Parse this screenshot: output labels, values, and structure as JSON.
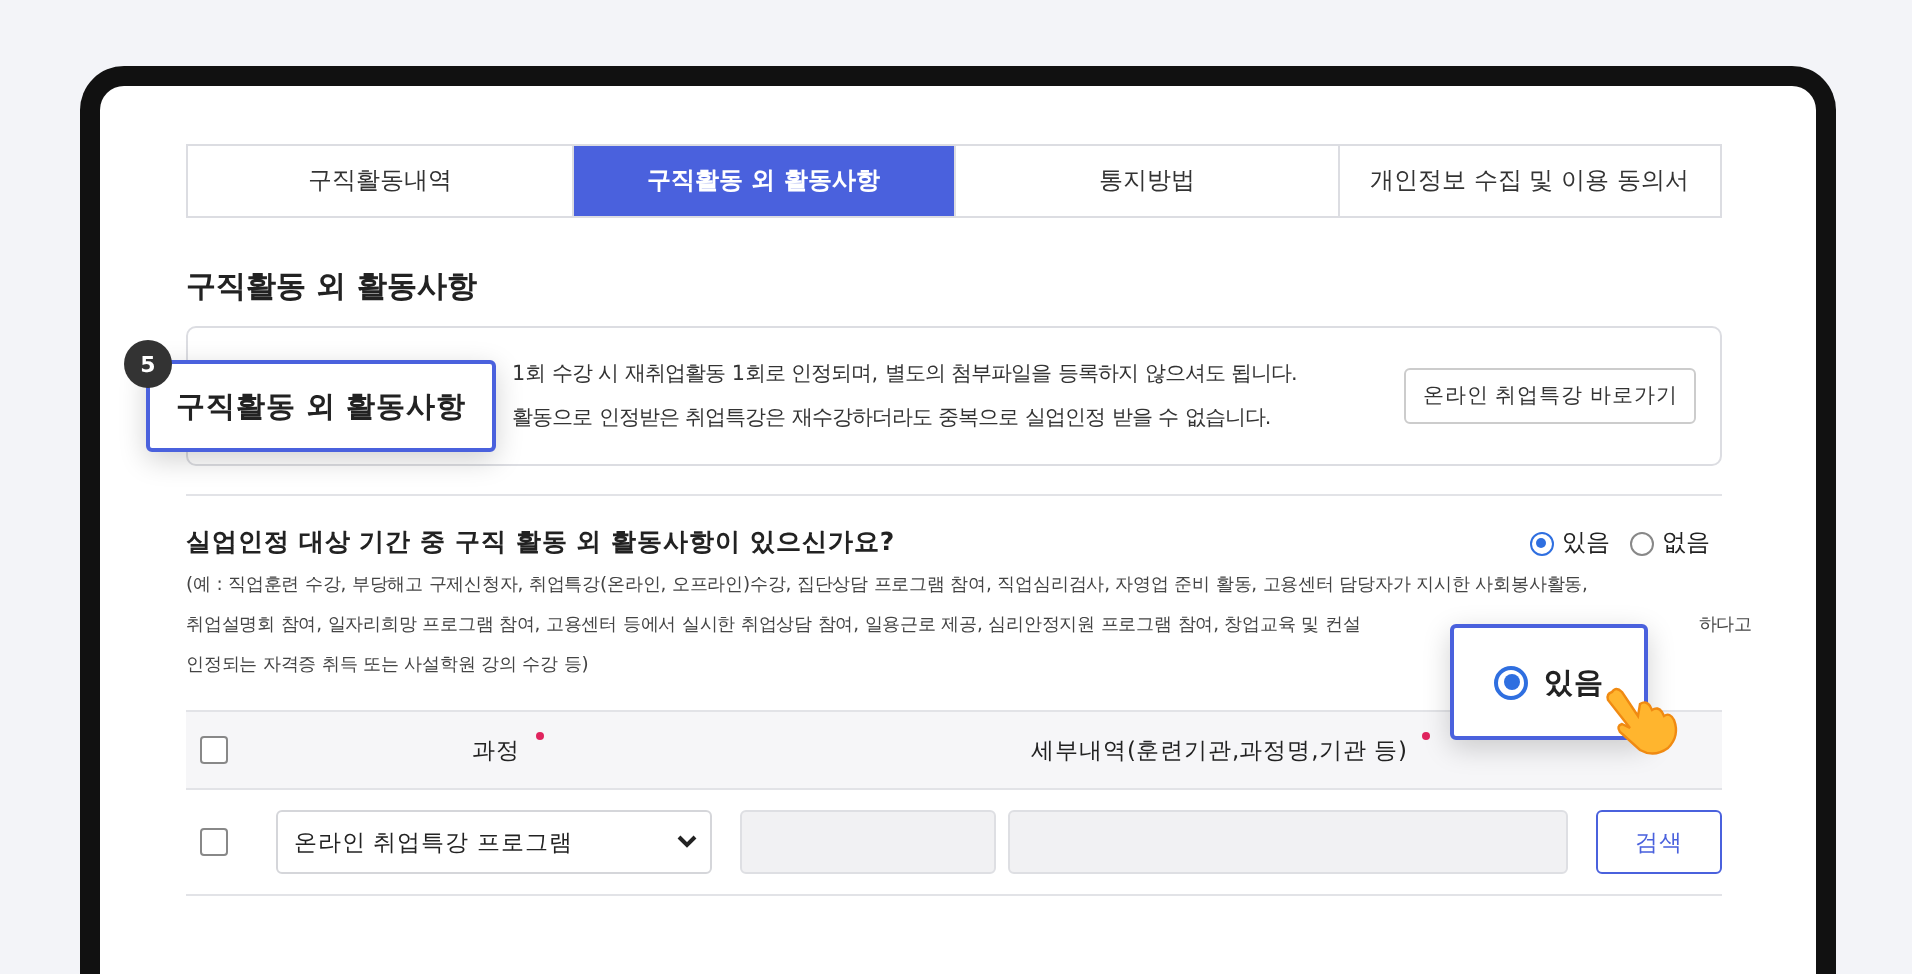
{
  "tabs": [
    {
      "label": "구직활동내역",
      "selected": false
    },
    {
      "label": "구직활동 외 활동사항",
      "selected": true
    },
    {
      "label": "통지방법",
      "selected": false
    },
    {
      "label": "개인정보 수집 및 이용 동의서",
      "selected": false
    }
  ],
  "section_title": "구직활동 외 활동사항",
  "info": {
    "lines": [
      "1회 수강 시 재취업활동 1회로 인정되며, 별도의 첨부파일을 등록하지 않으셔도 됩니다.",
      "활동으로 인정받은 취업특강은 재수강하더라도 중복으로 실업인정 받을 수 없습니다."
    ],
    "button": "온라인 취업특강 바로가기"
  },
  "question": {
    "text": "실업인정 대상 기간 중 구직 활동 외 활동사항이 있으신가요?",
    "options": [
      {
        "label": "있음",
        "selected": true
      },
      {
        "label": "없음",
        "selected": false
      }
    ],
    "example_lines": [
      [
        "(예 : 직업훈련 수강, 부당해고 구제신청자, 취업특강(온라인, 오프라인)수강, 집단상담 프로그램 참여, 직업심리검사, 자영업 준비 활동, 고용센터 담당자가 지시한 사회봉사활동,"
      ],
      [
        "취업설명회 참여, 일자리희망 프로그램 참여, 고용센터 등에서 실시한 취업상담 참여, 일용근로 제공, 심리안정지원 프로그램 참여, 창업교육 및 컨설",
        "하다고"
      ],
      [
        "인정되는 자격증 취득 또는 사설학원 강의 수강 등)"
      ]
    ]
  },
  "table": {
    "header_checkbox": {
      "checked": false
    },
    "columns": [
      {
        "label": "과정",
        "required": true
      },
      {
        "label": "세부내역(훈련기관,과정명,기관 등)",
        "required": true
      }
    ],
    "rows": [
      {
        "checked": false,
        "course": "온라인 취업특강 프로그램",
        "button": "검색"
      }
    ]
  },
  "callouts": [
    {
      "kind": "badge-label",
      "number": "5",
      "text": "구직활동 외 활동사항"
    },
    {
      "kind": "radio",
      "text": "있음",
      "selected": true
    }
  ]
}
